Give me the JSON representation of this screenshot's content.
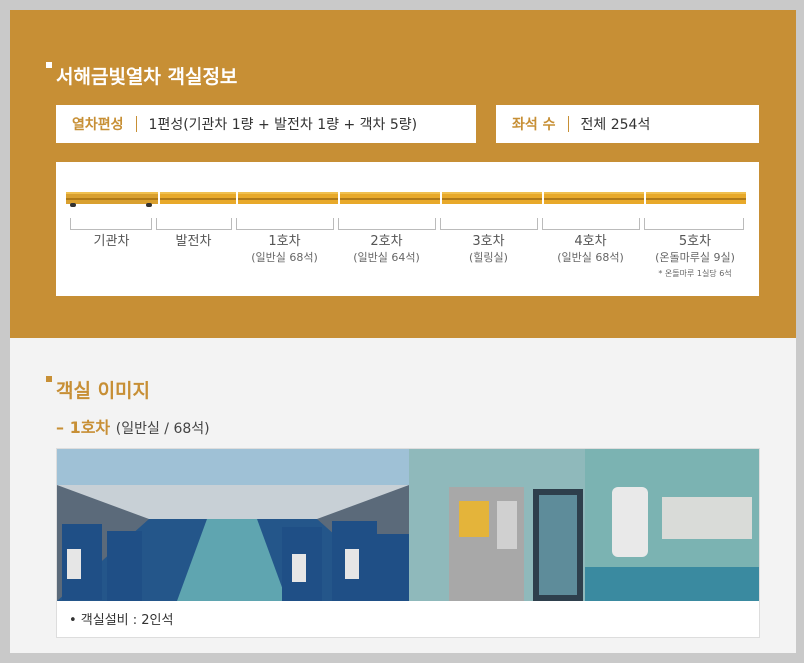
{
  "section1": {
    "title": "서해금빛열차 객실정보",
    "formation_label": "열차편성",
    "formation_value": "1편성(기관차 1량 + 발전차 1량 + 객차 5량)",
    "seats_label": "좌석 수",
    "seats_value": "전체 254석"
  },
  "cars": [
    {
      "name": "기관차",
      "sub": ""
    },
    {
      "name": "발전차",
      "sub": ""
    },
    {
      "name": "1호차",
      "sub": "(일반실 68석)"
    },
    {
      "name": "2호차",
      "sub": "(일반실 64석)"
    },
    {
      "name": "3호차",
      "sub": "(힐링실)"
    },
    {
      "name": "4호차",
      "sub": "(일반실 68석)"
    },
    {
      "name": "5호차",
      "sub": "(온돌마루실 9실)",
      "note": "* 온돌마루 1실당 6석"
    }
  ],
  "section2": {
    "title": "객실 이미지",
    "car_title": "– 1호차",
    "car_detail": "(일반실 / 68석)",
    "caption": "• 객실설비 : 2인석"
  },
  "colors": {
    "accent": "#c78f35",
    "train": "#e8a92a"
  }
}
